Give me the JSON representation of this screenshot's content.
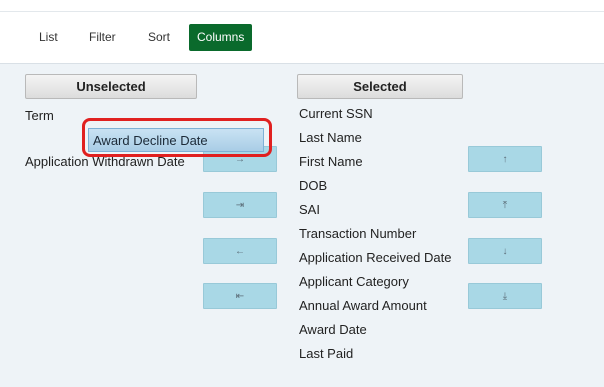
{
  "tabs": [
    "List",
    "Filter",
    "Sort",
    "Columns"
  ],
  "unselected": {
    "header": "Unselected",
    "items": [
      "Term",
      "Award Decline Date",
      "Application Withdrawn Date"
    ]
  },
  "selected": {
    "header": "Selected",
    "items": [
      "Current SSN",
      "Last Name",
      "First Name",
      "DOB",
      "SAI",
      "Transaction Number",
      "Application Received Date",
      "Applicant Category",
      "Annual Award Amount",
      "Award Date",
      "Last Paid"
    ]
  },
  "buttons": {
    "add": "→",
    "add_all": "⇥",
    "remove": "←",
    "remove_all": "⇤",
    "move_up": "↑",
    "move_top": "⤒",
    "move_down": "↓",
    "move_bottom": "⤓"
  },
  "colors": {
    "active_tab": "#0a6a2c",
    "button": "#a9d8e6",
    "highlight": "#e02020"
  }
}
